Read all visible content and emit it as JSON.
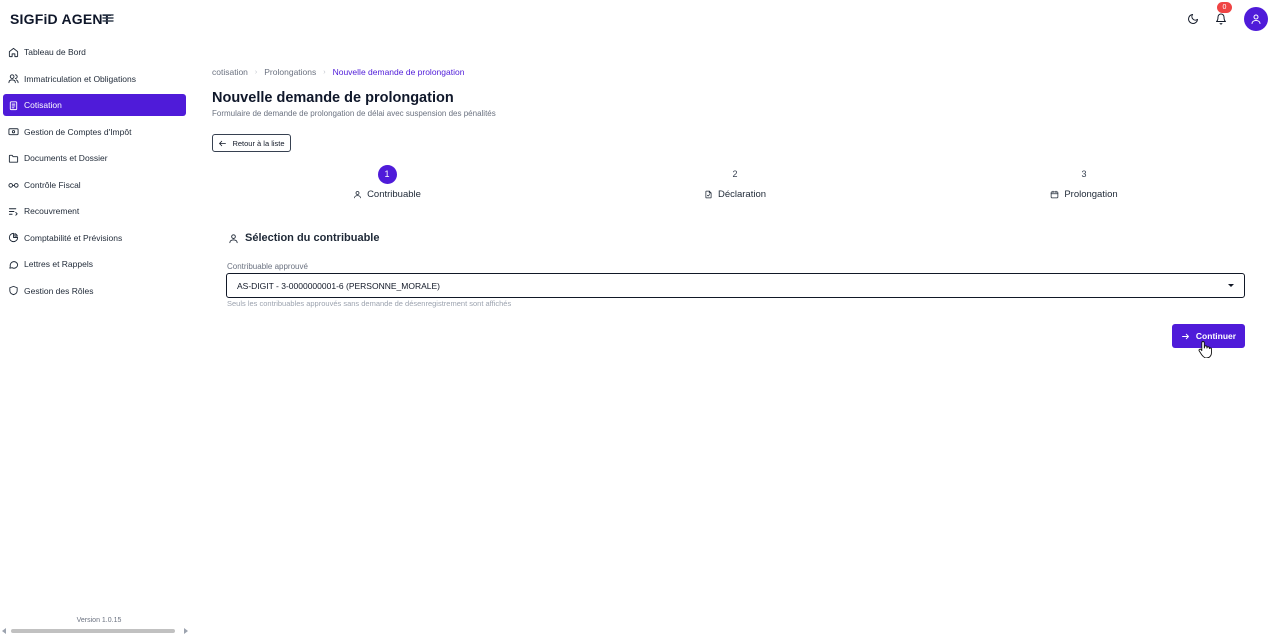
{
  "app": {
    "brand": "SIGFiD AGENT",
    "notifications_count": "0",
    "version": "Version 1.0.15"
  },
  "sidebar": {
    "items": [
      {
        "label": "Tableau de Bord",
        "icon": "home-icon"
      },
      {
        "label": "Immatriculation et Obligations",
        "icon": "users-icon"
      },
      {
        "label": "Cotisation",
        "icon": "clipboard-icon",
        "active": true
      },
      {
        "label": "Gestion de Comptes d'Impôt",
        "icon": "card-icon"
      },
      {
        "label": "Documents et Dossier",
        "icon": "folder-icon"
      },
      {
        "label": "Contrôle Fiscal",
        "icon": "glasses-icon"
      },
      {
        "label": "Recouvrement",
        "icon": "list-icon"
      },
      {
        "label": "Comptabilité et Prévisions",
        "icon": "pie-chart-icon"
      },
      {
        "label": "Lettres et Rappels",
        "icon": "message-icon"
      },
      {
        "label": "Gestion des Rôles",
        "icon": "shield-icon"
      }
    ]
  },
  "breadcrumb": {
    "items": [
      "cotisation",
      "Prolongations"
    ],
    "current": "Nouvelle demande de prolongation"
  },
  "page": {
    "title": "Nouvelle demande de prolongation",
    "subtitle": "Formulaire de demande de prolongation de délai avec suspension des pénalités",
    "back_label": "Retour à la liste"
  },
  "stepper": {
    "steps": [
      {
        "number": "1",
        "label": "Contribuable",
        "icon": "user-icon",
        "active": true
      },
      {
        "number": "2",
        "label": "Déclaration",
        "icon": "file-icon",
        "active": false
      },
      {
        "number": "3",
        "label": "Prolongation",
        "icon": "calendar-icon",
        "active": false
      }
    ]
  },
  "section": {
    "title": "Sélection du contribuable",
    "field_label": "Contribuable approuvé",
    "selected_value": "AS-DIGIT - 3-0000000001-6 (PERSONNE_MORALE)",
    "helper": "Seuls les contribuables approuvés sans demande de désenregistrement sont affichés",
    "continue_label": "Continuer"
  },
  "colors": {
    "accent": "#4f1bd9",
    "badge": "#ef4444"
  }
}
